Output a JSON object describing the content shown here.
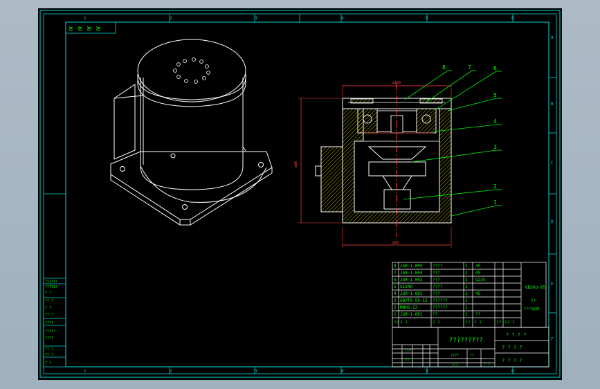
{
  "colors": {
    "frame": "#00d8d8",
    "line": "#ffffff",
    "dim": "#ff4040",
    "hatch": "#ffff00",
    "text": "#00ff00",
    "leader": "#00ff00",
    "bg": "#000000"
  },
  "ruler": {
    "top": [
      "1",
      "2",
      "3",
      "4",
      "5",
      "6"
    ],
    "bottom": [
      "1",
      "2",
      "3",
      "4",
      "5",
      "6"
    ],
    "right": [
      "A",
      "B",
      "C",
      "D",
      "E",
      "F"
    ]
  },
  "corner_symbols": "≥ ≥ ≥ ≥",
  "section_view": {
    "dim_top": "ø100",
    "dim_left": "ø80",
    "dim_bottom": "ø80",
    "balloons": [
      "8",
      "7",
      "6",
      "5",
      "4",
      "3",
      "2",
      "1"
    ]
  },
  "bom": {
    "rows": [
      {
        "no": "8",
        "code": "JGR-1-005",
        "name": "????",
        "qty": "1",
        "mat": "45"
      },
      {
        "no": "7",
        "code": "JGR-1-004",
        "name": "???",
        "qty": "1",
        "mat": "45"
      },
      {
        "no": "6",
        "code": "JGR-1-003",
        "name": "???",
        "qty": "1",
        "mat": "Q235"
      },
      {
        "no": "5",
        "code": "51340",
        "name": "????",
        "qty": "1",
        "mat": ""
      },
      {
        "no": "4",
        "code": "JGR-1-002",
        "name": "???",
        "qty": "1",
        "mat": "45"
      },
      {
        "no": "3",
        "code": "GB/T9-59-15",
        "name": "??????",
        "qty": "1",
        "mat": ""
      },
      {
        "no": "2",
        "code": "MHHS-12",
        "name": "??????",
        "qty": "1",
        "mat": ""
      },
      {
        "no": "1",
        "code": "JGR-1-001",
        "name": "??",
        "qty": "1",
        "mat": "??"
      }
    ],
    "header": [
      "??",
      "? ?",
      "? ?",
      "??",
      "? ?",
      "??",
      "?? ?"
    ],
    "side_top": "GB30U-95",
    "side_mid": "??",
    "side_bot": "????比例"
  },
  "title_block": {
    "drawing_name": "?????????",
    "right_top": "? ? ? ?",
    "right_mid": "? ? ? ?",
    "right_bot": "? ? ? ?",
    "grid_a": "????",
    "grid_b": "?? ?",
    "grid_c": "??",
    "grid_d": "1/1",
    "grid_e": "????",
    "grid_f": "? ?"
  },
  "left_panel": [
    "?11?3?",
    "??771?",
    "? ?",
    "?? ?",
    "? ?",
    "?? ?",
    "????",
    "?????",
    "????",
    "??  ?",
    "??  ?",
    "? ?"
  ]
}
